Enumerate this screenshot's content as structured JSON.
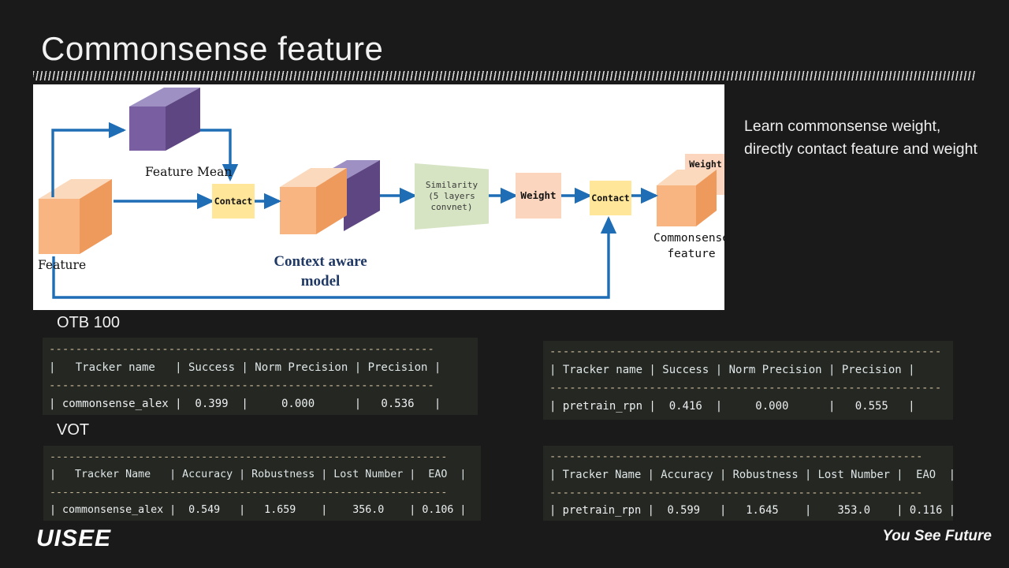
{
  "slide": {
    "title": "Commonsense feature",
    "note": "Learn commonsense weight, directly contact feature and weight"
  },
  "diagram": {
    "labels": {
      "feature": "Feature",
      "feature_mean": "Feature Mean",
      "contact_1": "Contact",
      "context_aware_model": "Context aware\nmodel",
      "similarity": "Similarity\n(5 layers\nconvnet)",
      "weight_box": "Weight",
      "contact_2": "Contact",
      "weight_tag": "Weight",
      "commonsense_feature": "Commonsense\nfeature"
    },
    "colors": {
      "cube_orange_top": "#fbd9bd",
      "cube_orange_front": "#f8b481",
      "cube_orange_side": "#ef9a5d",
      "cube_purple_top": "#9f90c4",
      "cube_purple_front": "#7a5ea2",
      "cube_purple_side": "#5d4682",
      "contact_box": "#ffe699",
      "weight_box": "#fbd5bd",
      "similarity_box": "#d6e4c3",
      "arrow": "#1f6eb5",
      "model_text": "#1f3864"
    }
  },
  "sections": [
    {
      "caption": "OTB 100"
    },
    {
      "caption": "VOT"
    }
  ],
  "tables": {
    "otb_left": {
      "rule": "----------------------------------------------------------",
      "header": "|   Tracker name   | Success | Norm Precision | Precision |",
      "row": "| commonsense_alex |  0.399  |     0.000      |   0.536   |"
    },
    "otb_right": {
      "rule": "-----------------------------------------------------------",
      "header": "| Tracker name | Success | Norm Precision | Precision |",
      "row": "| pretrain_rpn |  0.416  |     0.000      |   0.555   |"
    },
    "vot_left": {
      "rule": "---------------------------------------------------------------",
      "header": "|   Tracker Name   | Accuracy | Robustness | Lost Number |  EAO  |",
      "row": "| commonsense_alex |  0.549   |   1.659    |    356.0    | 0.106 |"
    },
    "vot_right": {
      "rule": "---------------------------------------------------------",
      "header": "| Tracker Name | Accuracy | Robustness | Lost Number |  EAO  |",
      "row": "| pretrain_rpn |  0.599   |   1.645    |    353.0    | 0.116 |"
    }
  },
  "footer": {
    "logo": "UISEE",
    "tagline": "You See Future"
  }
}
